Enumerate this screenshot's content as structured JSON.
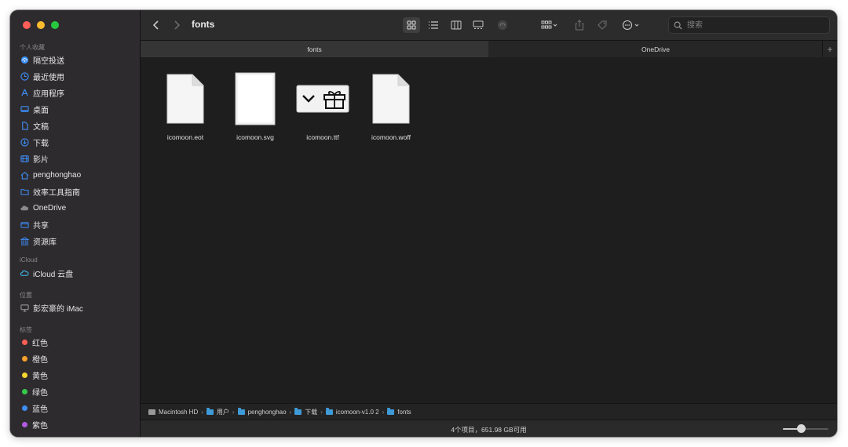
{
  "window": {
    "title": "fonts"
  },
  "sidebar": {
    "sections": [
      {
        "label": "个人收藏"
      },
      {
        "label": "iCloud"
      },
      {
        "label": "位置"
      },
      {
        "label": "标签"
      }
    ],
    "favorites": [
      {
        "label": "隔空投送",
        "icon": "airdrop-icon"
      },
      {
        "label": "最近使用",
        "icon": "clock-icon"
      },
      {
        "label": "应用程序",
        "icon": "applications-icon"
      },
      {
        "label": "桌面",
        "icon": "desktop-icon"
      },
      {
        "label": "文稿",
        "icon": "document-icon"
      },
      {
        "label": "下载",
        "icon": "download-icon"
      },
      {
        "label": "影片",
        "icon": "film-icon"
      },
      {
        "label": "penghonghao",
        "icon": "home-icon"
      },
      {
        "label": "效率工具指南",
        "icon": "folder-icon"
      },
      {
        "label": "OneDrive",
        "icon": "cloud-icon"
      },
      {
        "label": "共享",
        "icon": "shared-folder-icon"
      },
      {
        "label": "资源库",
        "icon": "library-icon"
      }
    ],
    "icloud": [
      {
        "label": "iCloud 云盘",
        "icon": "icloud-icon"
      }
    ],
    "locations": [
      {
        "label": "彭宏豪的 iMac",
        "icon": "imac-icon"
      }
    ],
    "tags": [
      {
        "label": "红色",
        "color": "#fe5f57"
      },
      {
        "label": "橙色",
        "color": "#f7a12a"
      },
      {
        "label": "黄色",
        "color": "#f5d52e"
      },
      {
        "label": "绿色",
        "color": "#35c84a"
      },
      {
        "label": "蓝色",
        "color": "#3d8ef7"
      },
      {
        "label": "紫色",
        "color": "#b25be0"
      }
    ]
  },
  "toolbar": {
    "search_placeholder": "搜索"
  },
  "tabs": [
    {
      "label": "fonts",
      "active": true
    },
    {
      "label": "OneDrive",
      "active": false
    }
  ],
  "files": [
    {
      "name": "icomoon.eot",
      "icon": "document-icon"
    },
    {
      "name": "icomoon.svg",
      "icon": "svg-preview-icon"
    },
    {
      "name": "icomoon.ttf",
      "icon": "font-preview-icon"
    },
    {
      "name": "icomoon.woff",
      "icon": "document-icon"
    }
  ],
  "pathbar": [
    {
      "label": "Macintosh HD",
      "icon": "hard-drive-icon"
    },
    {
      "label": "用户",
      "icon": "folder-icon"
    },
    {
      "label": "penghonghao",
      "icon": "folder-icon"
    },
    {
      "label": "下载",
      "icon": "folder-icon"
    },
    {
      "label": "icomoon-v1.0 2",
      "icon": "folder-icon"
    },
    {
      "label": "fonts",
      "icon": "folder-icon"
    }
  ],
  "status": {
    "text": "4个项目，651.98 GB可用",
    "icon_size_level": 0.4
  },
  "colors": {
    "sidebar_bg": "#2e2b2e",
    "content_bg": "#1e1e1e",
    "accent": "#3f9ad8"
  }
}
